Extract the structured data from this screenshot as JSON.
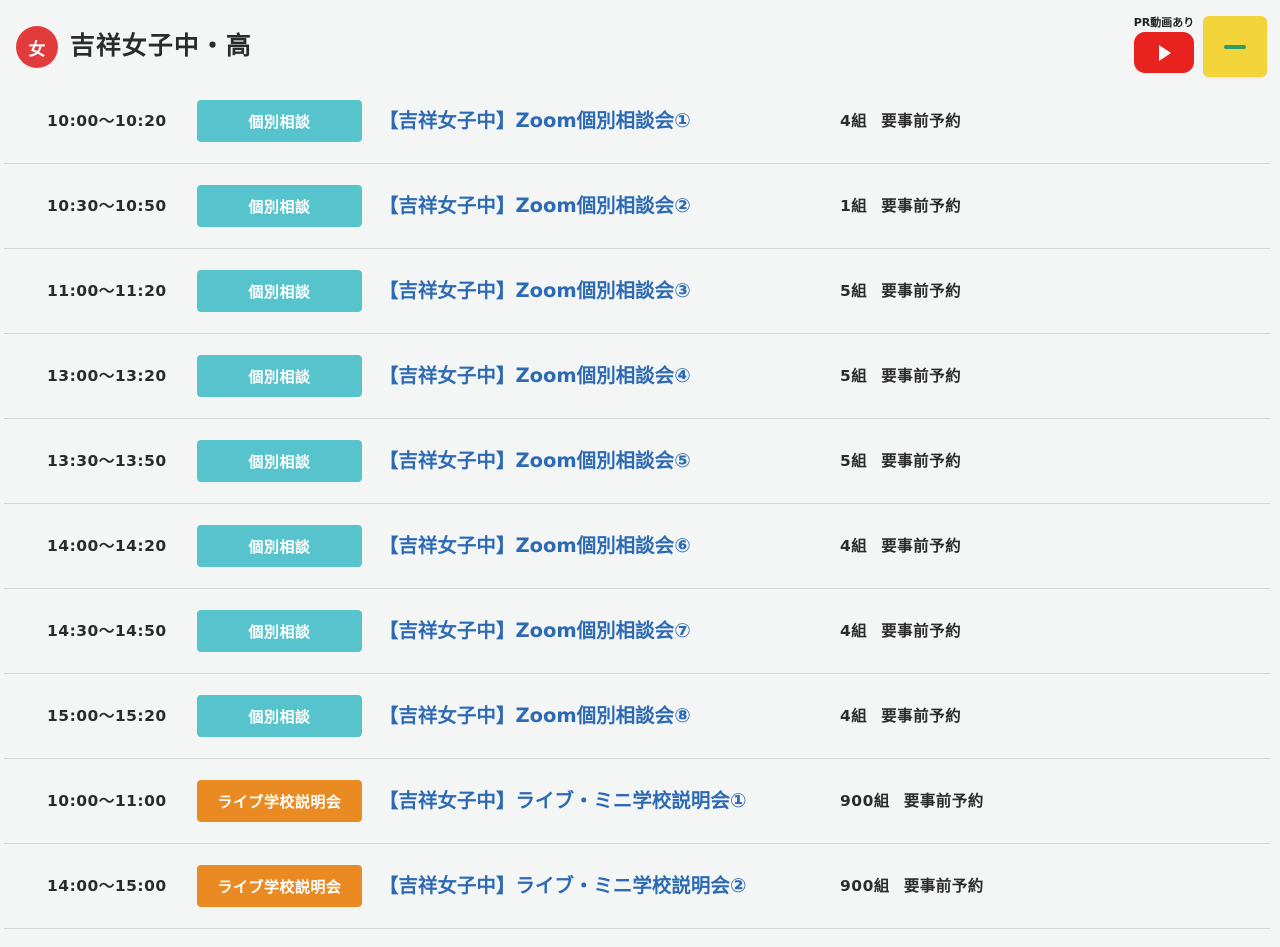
{
  "header": {
    "badge_label": "女",
    "school_name": "吉祥女子中・高",
    "pr_label": "PR動画あり",
    "youtube_icon": "youtube-play-icon",
    "toggle_icon": "minus-icon",
    "colors": {
      "badge": "#e23b3b",
      "youtube": "#e8231f",
      "toggle": "#f3d43a",
      "minus": "#2f9c6d"
    }
  },
  "events": [
    {
      "time": "10:00〜10:20",
      "tag": "個別相談",
      "type": "consult",
      "title": "【吉祥女子中】Zoom個別相談会①",
      "capacity": "4組",
      "reservation": "要事前予約"
    },
    {
      "time": "10:30〜10:50",
      "tag": "個別相談",
      "type": "consult",
      "title": "【吉祥女子中】Zoom個別相談会②",
      "capacity": "1組",
      "reservation": "要事前予約"
    },
    {
      "time": "11:00〜11:20",
      "tag": "個別相談",
      "type": "consult",
      "title": "【吉祥女子中】Zoom個別相談会③",
      "capacity": "5組",
      "reservation": "要事前予約"
    },
    {
      "time": "13:00〜13:20",
      "tag": "個別相談",
      "type": "consult",
      "title": "【吉祥女子中】Zoom個別相談会④",
      "capacity": "5組",
      "reservation": "要事前予約"
    },
    {
      "time": "13:30〜13:50",
      "tag": "個別相談",
      "type": "consult",
      "title": "【吉祥女子中】Zoom個別相談会⑤",
      "capacity": "5組",
      "reservation": "要事前予約"
    },
    {
      "time": "14:00〜14:20",
      "tag": "個別相談",
      "type": "consult",
      "title": "【吉祥女子中】Zoom個別相談会⑥",
      "capacity": "4組",
      "reservation": "要事前予約"
    },
    {
      "time": "14:30〜14:50",
      "tag": "個別相談",
      "type": "consult",
      "title": "【吉祥女子中】Zoom個別相談会⑦",
      "capacity": "4組",
      "reservation": "要事前予約"
    },
    {
      "time": "15:00〜15:20",
      "tag": "個別相談",
      "type": "consult",
      "title": "【吉祥女子中】Zoom個別相談会⑧",
      "capacity": "4組",
      "reservation": "要事前予約"
    },
    {
      "time": "10:00〜11:00",
      "tag": "ライブ学校説明会",
      "type": "live",
      "title": "【吉祥女子中】ライブ・ミニ学校説明会①",
      "capacity": "900組",
      "reservation": "要事前予約"
    },
    {
      "time": "14:00〜15:00",
      "tag": "ライブ学校説明会",
      "type": "live",
      "title": "【吉祥女子中】ライブ・ミニ学校説明会②",
      "capacity": "900組",
      "reservation": "要事前予約"
    }
  ],
  "tag_colors": {
    "consult": "#57c3cd",
    "live": "#ea8a22",
    "title_link": "#2d6ab4"
  }
}
